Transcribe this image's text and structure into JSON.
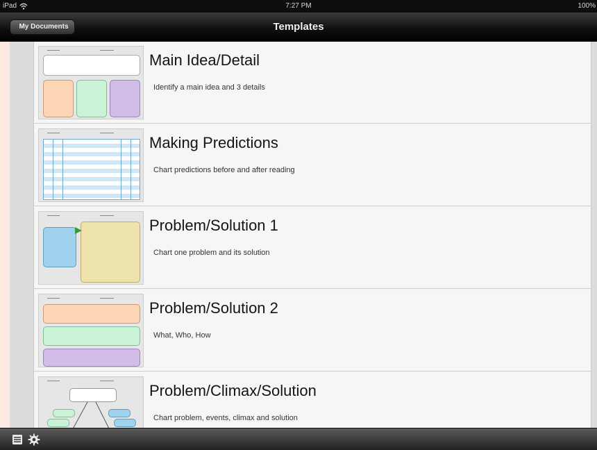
{
  "status_bar": {
    "carrier": "iPad",
    "time": "7:27 PM",
    "battery": "100%"
  },
  "nav": {
    "title": "Templates",
    "back_label": "My Documents"
  },
  "templates": [
    {
      "title": "Main Idea/Detail",
      "description": "Identify a main idea and 3 details"
    },
    {
      "title": "Making Predictions",
      "description": "Chart predictions before and after reading"
    },
    {
      "title": "Problem/Solution 1",
      "description": "Chart one problem and its solution"
    },
    {
      "title": "Problem/Solution 2",
      "description": "What, Who, How"
    },
    {
      "title": "Problem/Climax/Solution",
      "description": "Chart problem, events, climax and solution"
    }
  ],
  "toolbar": {
    "icons": [
      "list-icon",
      "gear-icon"
    ]
  },
  "colors": {
    "peach": "#fcd6b4",
    "mint": "#c9f2d6",
    "lavender": "#d2bde9",
    "sky": "#9fd2ec",
    "khaki": "#eee3ad"
  }
}
